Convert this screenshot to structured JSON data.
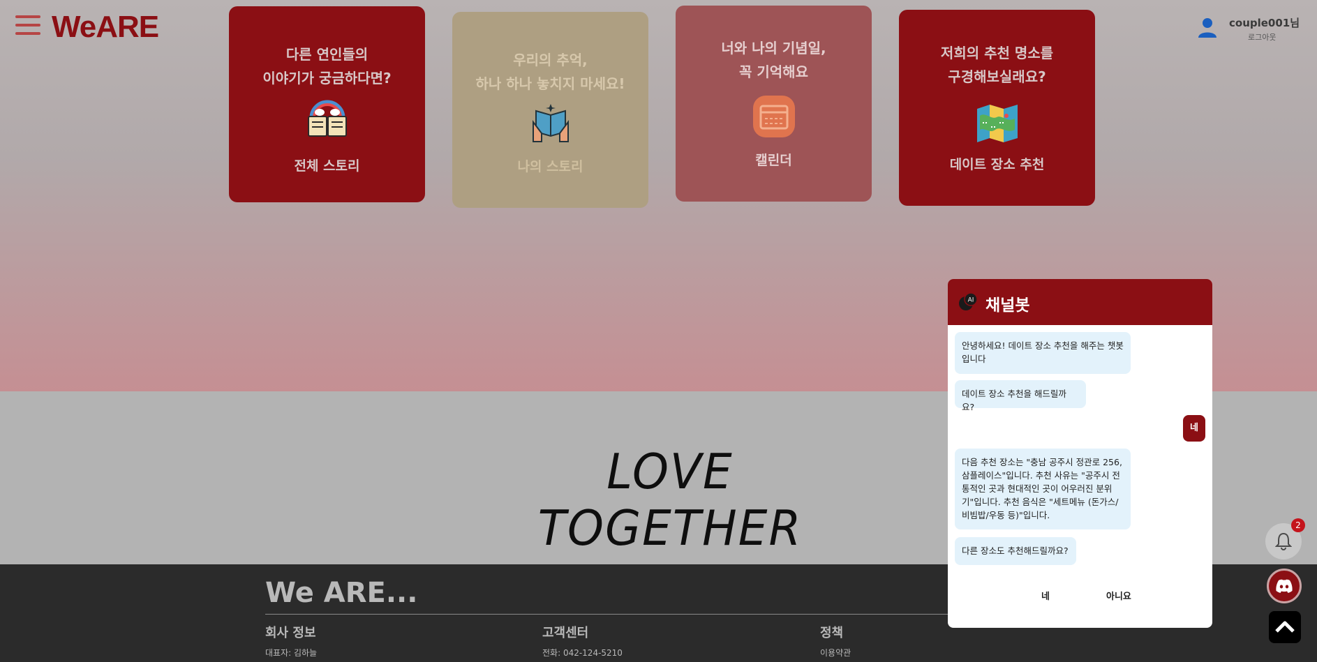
{
  "header": {
    "logo": "WeARE",
    "user_name": "couple001님",
    "logout_label": "로그아웃"
  },
  "cards": [
    {
      "title": "다른 연인들의\n이야기가 궁금하다면?",
      "label": "전체 스토리",
      "icon": "open-book-icon"
    },
    {
      "title": "우리의 추억,\n하나 하나 놓치지 마세요!",
      "label": "나의 스토리",
      "icon": "reading-book-icon"
    },
    {
      "title": "너와 나의 기념일,\n꼭 기억해요",
      "label": "캘린더",
      "icon": "calendar-icon"
    },
    {
      "title": "저희의 추천 명소를\n구경해보실래요?",
      "label": "데이트 장소 추천",
      "icon": "map-icon"
    }
  ],
  "slogan": "LOVE TOGETHER",
  "footer": {
    "brand": "We ARE...",
    "columns": [
      {
        "title": "회사 정보",
        "item": "대표자: 김하늘"
      },
      {
        "title": "고객센터",
        "item": "전화: 042-124-5210"
      },
      {
        "title": "정책",
        "item": "이용약관"
      }
    ]
  },
  "chatbot": {
    "title": "채널봇",
    "messages": [
      "안녕하세요! 데이트 장소 추천을 해주는 챗봇입니다",
      "데이트 장소 추천을 해드릴까요?",
      "다음 추천 장소는 \"충남 공주시 정관로 256, 삼플레이스\"입니다. 추천 사유는 \"공주시 전통적인 곳과 현대적인 곳이 어우러진 분위기\"입니다. 추천 음식은 \"세트메뉴 (돈가스/비빔밥/우동 등)\"입니다.",
      "다른 장소도 추천해드릴까요?"
    ],
    "user_reply": "네",
    "choice_yes": "네",
    "choice_no": "아니요"
  },
  "notifications": {
    "count": "2"
  },
  "colors": {
    "brand": "#8b0f14",
    "bubble": "#e3f2fb",
    "footer": "#2b2b2b"
  }
}
